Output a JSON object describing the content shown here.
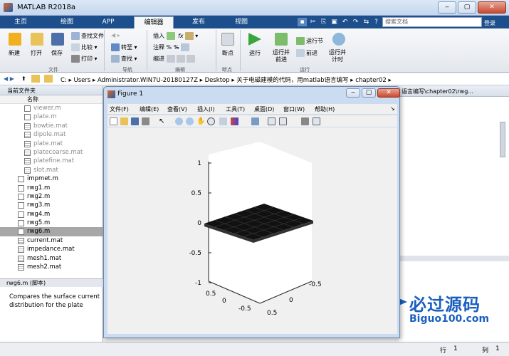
{
  "window": {
    "title": "MATLAB R2018a",
    "min": "‒",
    "max": "▢",
    "close": "✕"
  },
  "tabs": [
    {
      "label": "主页"
    },
    {
      "label": "绘图"
    },
    {
      "label": "APP"
    },
    {
      "label": "编辑器"
    },
    {
      "label": "发布"
    },
    {
      "label": "视图"
    }
  ],
  "search": {
    "placeholder": "搜索文档",
    "button": "登录"
  },
  "ribbon": {
    "new": "新建",
    "open": "打开",
    "save": "保存",
    "find_files": "查找文件",
    "compare": "比较",
    "print": "打印",
    "goto": "转至",
    "find": "查找",
    "insert": "插入",
    "comment": "注释",
    "indent": "缩进",
    "breakpoint": "断点",
    "run": "运行",
    "run_advance": "运行并\n前进",
    "run_section": "运行节",
    "advance": "前进",
    "run_time": "运行并\n计时",
    "groups": {
      "file": "文件",
      "navigate": "导航",
      "edit": "编辑",
      "breakpoints": "断点",
      "run": "运行"
    }
  },
  "path": {
    "segments": [
      "C:",
      "Users",
      "Administrator.WIN7U-20180127Z",
      "Desktop",
      "关于电磁建模的代码，用matlab语言编写",
      "chapter02"
    ]
  },
  "current_folder": {
    "title": "当前文件夹",
    "column": "名称",
    "files": [
      {
        "name": "viewer.m",
        "type": "m",
        "gray": true,
        "indent": true
      },
      {
        "name": "plate.m",
        "type": "m",
        "gray": true,
        "indent": true
      },
      {
        "name": "bowtie.mat",
        "type": "mat",
        "gray": true,
        "indent": true
      },
      {
        "name": "dipole.mat",
        "type": "mat",
        "gray": true,
        "indent": true
      },
      {
        "name": "plate.mat",
        "type": "mat",
        "gray": true,
        "indent": true
      },
      {
        "name": "platecoarse.mat",
        "type": "mat",
        "gray": true,
        "indent": true
      },
      {
        "name": "platefine.mat",
        "type": "mat",
        "gray": true,
        "indent": true
      },
      {
        "name": "slot.mat",
        "type": "mat",
        "gray": true,
        "indent": true
      },
      {
        "name": "impmet.m",
        "type": "m"
      },
      {
        "name": "rwg1.m",
        "type": "m"
      },
      {
        "name": "rwg2.m",
        "type": "m"
      },
      {
        "name": "rwg3.m",
        "type": "m"
      },
      {
        "name": "rwg4.m",
        "type": "m"
      },
      {
        "name": "rwg5.m",
        "type": "m"
      },
      {
        "name": "rwg6.m",
        "type": "m",
        "selected": true
      },
      {
        "name": "current.mat",
        "type": "mat"
      },
      {
        "name": "impedance.mat",
        "type": "mat"
      },
      {
        "name": "mesh1.mat",
        "type": "mat"
      },
      {
        "name": "mesh2.mat",
        "type": "mat"
      }
    ],
    "detail_title": "rwg6.m  (脚本)",
    "detail_desc": "Compares the surface current distribution for the plate"
  },
  "editor_path": "语言编写\\chapter02\\rwg...",
  "figure": {
    "title": "Figure 1",
    "menu": [
      "文件(F)",
      "编辑(E)",
      "查看(V)",
      "插入(I)",
      "工具(T)",
      "桌面(D)",
      "窗口(W)",
      "帮助(H)"
    ],
    "z_ticks": [
      "1",
      "0.5",
      "0",
      "-0.5",
      "-1"
    ],
    "x_ticks": [
      "-0.5",
      "0",
      "0.5"
    ],
    "y_ticks": [
      "-0.5",
      "0",
      "0.5"
    ]
  },
  "status": {
    "row_label": "行",
    "row": "1",
    "col_label": "列",
    "col": "1"
  },
  "watermark": {
    "cn": "必过源码",
    "en": "Biguo100.com"
  }
}
